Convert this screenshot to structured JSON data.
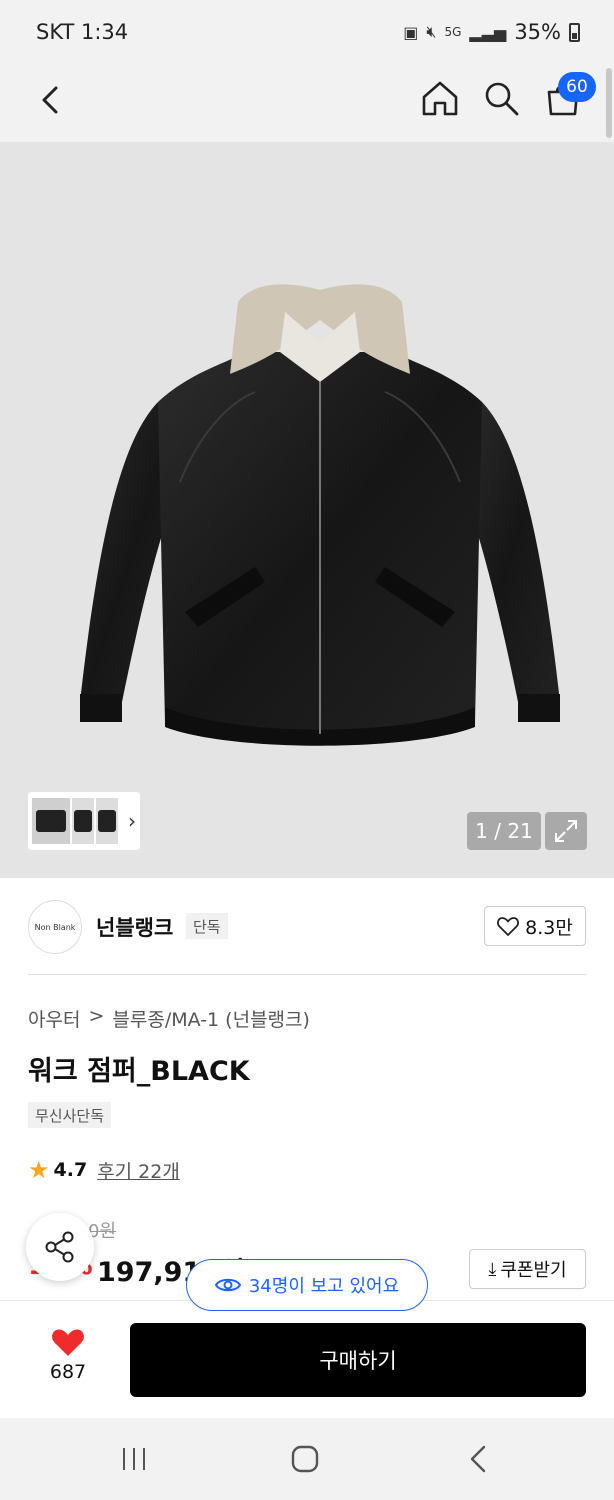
{
  "status_bar": {
    "carrier_time": "SKT 1:34",
    "network": "5G",
    "battery": "35%",
    "icons": [
      "battery-saver-icon",
      "mute-icon",
      "signal-icon",
      "battery-icon"
    ]
  },
  "header": {
    "cart_count": "60",
    "icons": [
      "back-icon",
      "home-icon",
      "search-icon",
      "cart-icon"
    ]
  },
  "gallery": {
    "counter": "1 / 21",
    "background_color": "#e4e4e4"
  },
  "brand": {
    "logo_text": "Non Blank",
    "name": "넌블랭크",
    "tag": "단독",
    "likes": "8.3만"
  },
  "breadcrumb": {
    "category": "아우터",
    "separator": ">",
    "subcategory": "블루종/MA-1 (넌블랭크)"
  },
  "product": {
    "title": "워크 점퍼_BLACK",
    "exclusive_tag": "무신사단독",
    "rating": "4.7",
    "reviews": "후기 22개",
    "original_price": "0원",
    "discount": "10%",
    "sale_price": "197,910원",
    "coupon_label": "쿠폰받기"
  },
  "viewers": {
    "text": "34명이 보고 있어요"
  },
  "bottom_bar": {
    "wish_count": "687",
    "buy_label": "구매하기"
  },
  "colors": {
    "accent_blue": "#1565ff",
    "discount_red": "#ef2b2b",
    "heart_red": "#ef2b2b",
    "star": "#f5a623",
    "buy_button": "#000000"
  }
}
